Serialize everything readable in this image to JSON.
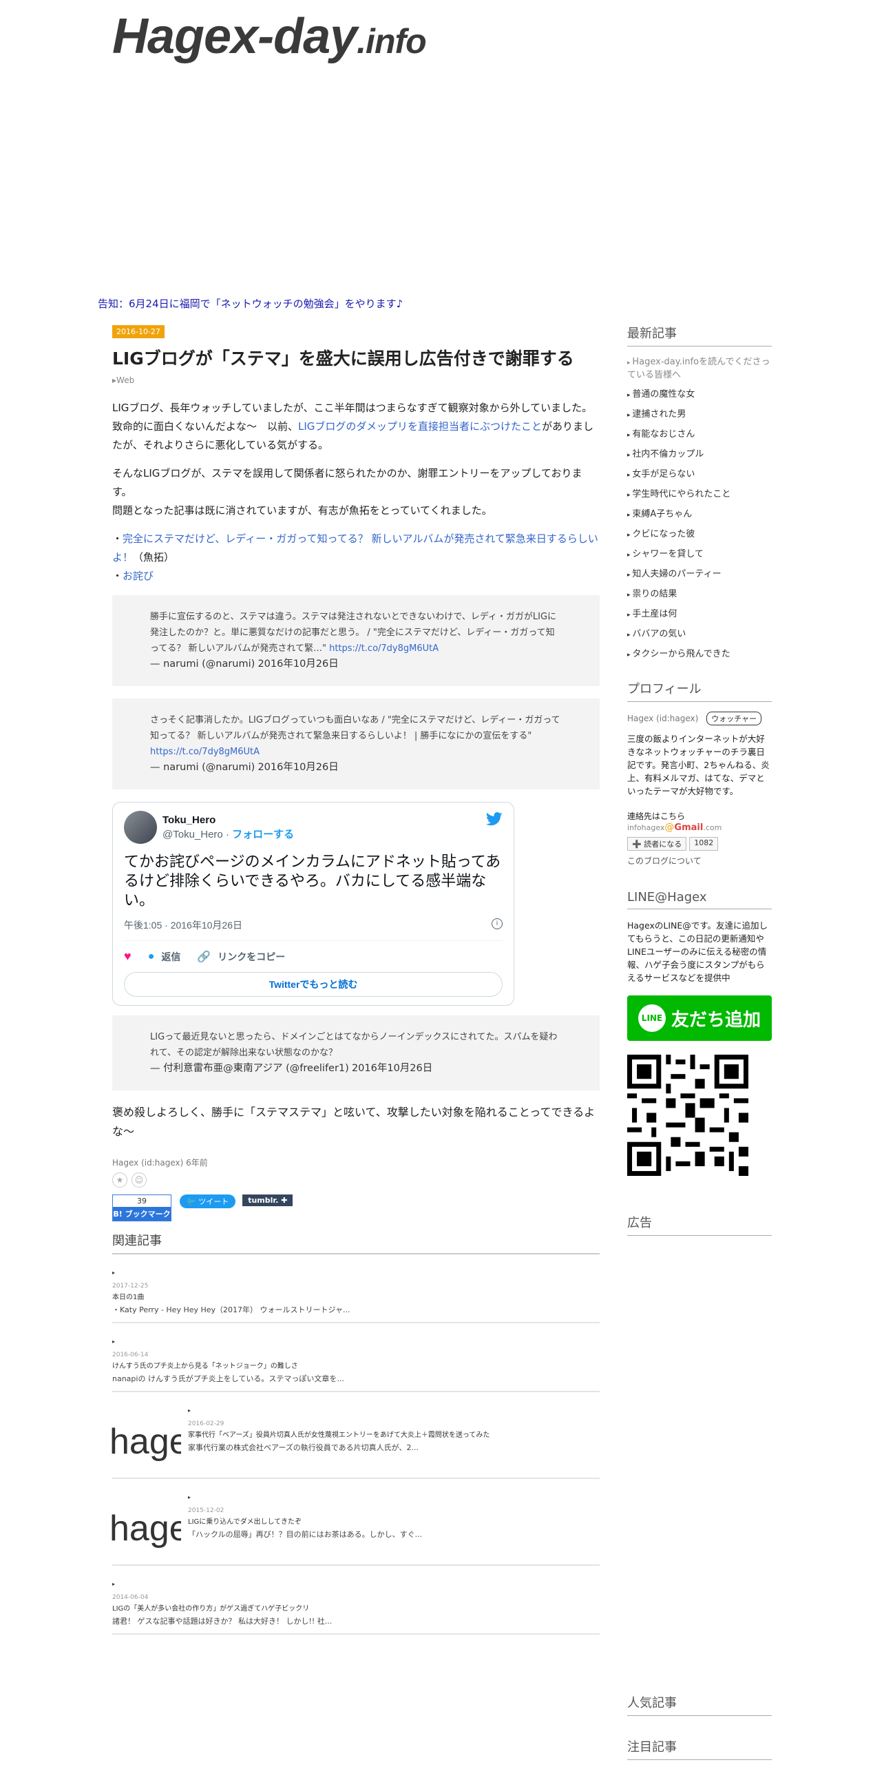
{
  "site": {
    "title_main": "Hagex-day",
    "title_suffix": ".info"
  },
  "notice": "告知：6月24日に福岡で「ネットウォッチの勉強会」をやります♪",
  "entry": {
    "date": "2016-10-27",
    "title": "LIGブログが「ステマ」を盛大に誤用し広告付きで謝罪する",
    "category": "Web",
    "p1_a": "LIGブログ、長年ウォッチしていましたが、ここ半年間はつまらなすぎて観察対象から外していました。致命的に面白くないんだよな〜　以前、",
    "p1_link": "LIGブログのダメップリを直接担当者にぶつけたこと",
    "p1_b": "がありましたが、それよりさらに悪化している気がする。",
    "p2": "そんなLIGブログが、ステマを誤用して関係者に怒られたかのか、謝罪エントリーをアップしております。",
    "p3": "問題となった記事は既に消されていますが、有志が魚拓をとっていてくれました。",
    "link1_prefix": "・",
    "link1": "完全にステマだけど、レディー・ガガって知ってる？ 新しいアルバムが発売されて緊急来日するらしいよ！",
    "link1_suffix": "（魚拓）",
    "link2_prefix": "・",
    "link2": "お詫び",
    "quotes": [
      {
        "text": "勝手に宣伝するのと、ステマは違う。ステマは発注されないとできないわけで、レディ・ガガがLIGに発注したのか？と。単に悪質なだけの記事だと思う。 / \"完全にステマだけど、レディー・ガガって知ってる？ 新しいアルバムが発売されて緊…\"",
        "link": "https://t.co/7dy8gM6UtA",
        "by": "— narumi (@narumi)",
        "date": "2016年10月26日"
      },
      {
        "text": "さっそく記事消したか。LIGブログっていつも面白いなあ / \"完全にステマだけど、レディー・ガガって知ってる？ 新しいアルバムが発売されて緊急来日するらしいよ！ | 勝手になにかの宣伝をする\"",
        "link": "https://t.co/7dy8gM6UtA",
        "by": "— narumi (@narumi)",
        "date": "2016年10月26日"
      }
    ],
    "tweet": {
      "name": "Toku_Hero",
      "handle": "@Toku_Hero",
      "sep": " · ",
      "follow": "フォローする",
      "text": "てかお詫びページのメインカラムにアドネット貼ってあるけど排除くらいできるやろ。バカにしてる感半端ない。",
      "time": "午後1:05 · 2016年10月26日",
      "reply": "返信",
      "copy": "リンクをコピー",
      "more": "Twitterでもっと読む"
    },
    "quote3": {
      "text": "LIGって最近見ないと思ったら、ドメインごとはてなからノーインデックスにされてた。スパムを疑われて、その認定が解除出来ない状態なのかな？",
      "by": "— 付利意雷布亜@東南アジア (@freelifer1)",
      "date": "2016年10月26日"
    },
    "closing": "褒め殺しよろしく、勝手に「ステマステマ」と呟いて、攻撃したい対象を陥れることってできるよな〜",
    "author": "Hagex (id:hagex)",
    "ago": "6年前",
    "hb_count": "39",
    "hb_label": "B! ブックマーク",
    "tweet_btn": "ツイート",
    "tumblr_btn": "tumblr."
  },
  "related": {
    "heading": "関連記事",
    "items": [
      {
        "date": "2017-12-25",
        "title": "本日の1曲",
        "excerpt": "・Katy Perry - Hey Hey Hey（2017年） ウォールストリートジャ...",
        "thumb": ""
      },
      {
        "date": "2016-06-14",
        "title": "けんすう氏のプチ炎上から見る「ネットジョーク」の難しさ",
        "excerpt": "nanapiの けんすう氏がプチ炎上をしている。ステマっぽい文章を...",
        "thumb": ""
      },
      {
        "date": "2016-02-29",
        "title": "家事代行「ベアーズ」役員片切真人氏が女性蔑視エントリーをあげて大炎上＋霞問状を送ってみた",
        "excerpt": "家事代行業の株式会社ベアーズの執行役員である片切真人氏が、2...",
        "thumb": "hage"
      },
      {
        "date": "2015-12-02",
        "title": "LIGに乗り込んでダメ出ししてきたぞ",
        "excerpt": "「ハックルの屈辱」再び！？目の前にはお茶はある。しかし、すぐ...",
        "thumb": "hage"
      },
      {
        "date": "2014-06-04",
        "title": "LIGの「美人が多い会社の作り方」がゲス過ぎてハゲ子ビックリ",
        "excerpt": "諸君！ ゲスな記事や話題は好きか？ 私は大好き！ しかし!! 社...",
        "thumb": ""
      }
    ]
  },
  "sidebar": {
    "recent_heading": "最新記事",
    "recent": [
      "Hagex-day.infoを読んでくださっている皆様へ",
      "普通の魔性な女",
      "逮捕された男",
      "有能なおじさん",
      "社内不倫カップル",
      "女手が足らない",
      "学生時代にやられたこと",
      "束縛A子ちゃん",
      "クビになった彼",
      "シャワーを貸して",
      "知人夫婦のパーティー",
      "祟りの結果",
      "手土産は何",
      "ババアの気い",
      "タクシーから飛んできた"
    ],
    "profile_heading": "プロフィール",
    "profile_id": "Hagex (id:hagex)",
    "profile_tag": "ウォッチャー",
    "profile_desc": "三度の飯よりインターネットが大好きなネットウォッチャーのチラ裏日記です。発言小町、2ちゃんねる、炎上、有料メルマガ、はてな、デマといったテーマが大好物です。",
    "contact_label": "連絡先はこちら",
    "contact_user": "infohagex",
    "contact_at": "@",
    "contact_domain": "Gmail",
    "contact_tld": ".com",
    "reader_btn": "➕ 読者になる",
    "reader_count": "1082",
    "about_link": "このブログについて",
    "line_heading": "LINE@Hagex",
    "line_desc": "HagexのLINE@です。友達に追加してもらうと、この日記の更新通知やLINEユーザーのみに伝える秘密の情報、ハゲ子会う度にスタンプがもらえるサービスなどを提供中",
    "line_logo": "LINE",
    "line_btn": "友だち追加",
    "ad_heading": "広告",
    "popular_heading": "人気記事",
    "featured_heading": "注目記事"
  },
  "colors": {
    "accent": "#f0a30a",
    "link": "#3366cc",
    "line_green": "#00b900",
    "twitter_blue": "#1d9bf0"
  }
}
